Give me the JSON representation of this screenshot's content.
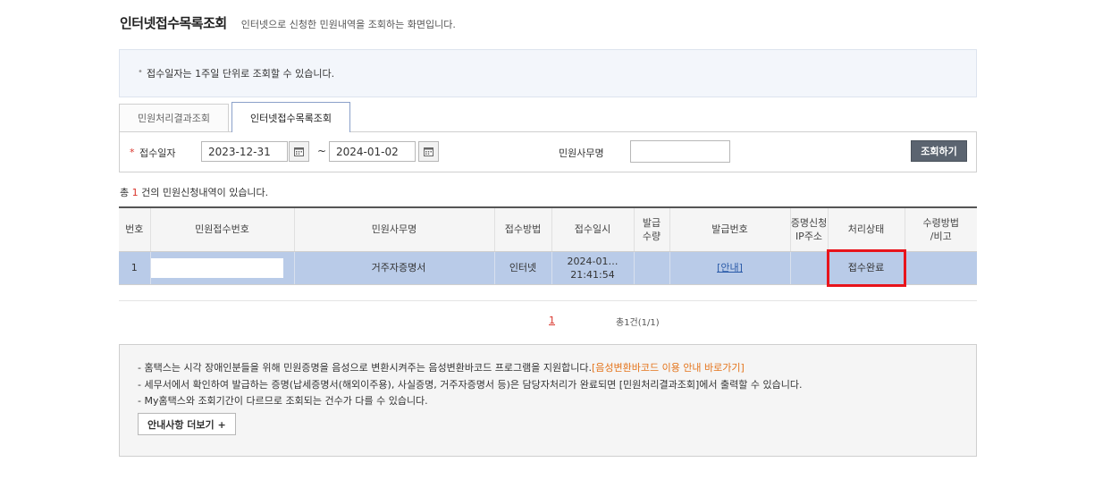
{
  "header": {
    "title": "인터넷접수목록조회",
    "subtitle": "인터넷으로 신청한 민원내역을 조회하는 화면입니다."
  },
  "notice": {
    "text": "접수일자는 1주일 단위로 조회할 수 있습니다."
  },
  "tabs": [
    {
      "label": "민원처리결과조회",
      "active": false
    },
    {
      "label": "인터넷접수목록조회",
      "active": true
    }
  ],
  "search": {
    "required_mark": "*",
    "date_label": "접수일자",
    "date_from": "2023-12-31",
    "date_to": "2024-01-02",
    "separator": "~",
    "office_label": "민원사무명",
    "office_value": "",
    "submit_label": "조회하기"
  },
  "results": {
    "prefix": "총",
    "count": "1",
    "suffix": "건의 민원신청내역이 있습니다."
  },
  "table": {
    "headers": [
      "번호",
      "민원접수번호",
      "민원사무명",
      "접수방법",
      "접수일시",
      "발급\n수량",
      "발급번호",
      "증명신청\nIP주소",
      "처리상태",
      "수령방법\n/비고"
    ],
    "rows": [
      {
        "no": "1",
        "receipt_no": "",
        "office_name": "거주자증명서",
        "method": "인터넷",
        "datetime_line1": "2024-01…",
        "datetime_line2": "21:41:54",
        "issue_qty": "",
        "issue_no": "[안내]",
        "ip": "",
        "status": "접수완료",
        "receive": ""
      }
    ]
  },
  "pager": {
    "current_page": "1",
    "total_text": "총1건(1/1)"
  },
  "info": {
    "line1": "- 홈택스는 시각 장애인분들을 위해 민원증명을 음성으로 변환시켜주는 음성변환바코드 프로그램을 지원합니다.",
    "line1_link": "[음성변환바코드 이용 안내 바로가기]",
    "line2": "- 세무서에서 확인하여 발급하는 증명(납세증명서(해외이주용), 사실증명, 거주자증명서 등)은 담당자처리가 완료되면 [민원처리결과조회]에서 출력할 수 있습니다.",
    "line3": "- My홈택스와 조회기간이 다르므로 조회되는 건수가 다를 수 있습니다.",
    "more_label": "안내사항 더보기 +"
  },
  "colors": {
    "row_highlight": "#b9cbe8",
    "status_outline": "#e8141b",
    "accent_red": "#d9342b",
    "link_orange": "#e4741b",
    "search_button": "#5b6470"
  }
}
